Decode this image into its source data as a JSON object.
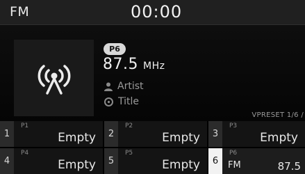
{
  "header": {
    "band": "FM",
    "clock": "00:00"
  },
  "now_playing": {
    "art_icon": "radio-broadcast-icon",
    "preset_badge": "P6",
    "frequency": "87.5",
    "frequency_unit": "MHz",
    "artist_icon": "person-icon",
    "artist": "Artist",
    "title_icon": "music-disc-icon",
    "title": "Title"
  },
  "page_indicator": "VPRESET 1/6 /",
  "presets": [
    {
      "number": "1",
      "label": "P1",
      "name": "Empty"
    },
    {
      "number": "2",
      "label": "P2",
      "name": "Empty"
    },
    {
      "number": "3",
      "label": "P3",
      "name": "Empty"
    },
    {
      "number": "4",
      "label": "P4",
      "name": "Empty"
    },
    {
      "number": "5",
      "label": "P5",
      "name": "Empty"
    },
    {
      "number": "6",
      "label": "P6",
      "band": "FM",
      "name": "87.5",
      "active": true
    }
  ],
  "colors": {
    "background": "#000000",
    "header_bar": "#202020",
    "slot_bg": "#141414",
    "slot_number_bg": "#2b2b2b",
    "active_number_bg": "#f2f2f2"
  }
}
